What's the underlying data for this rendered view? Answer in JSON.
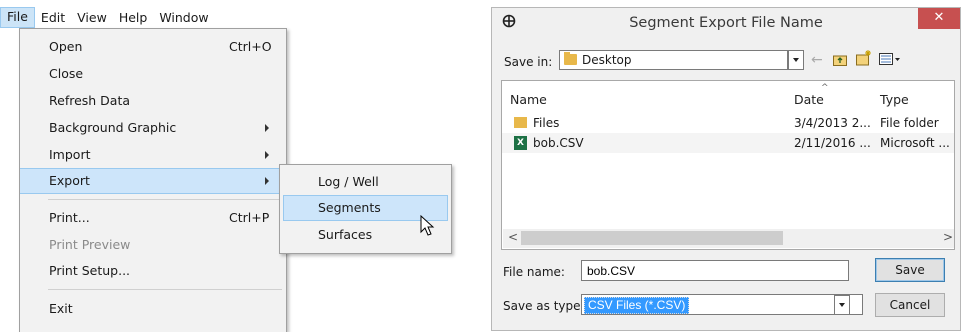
{
  "menubar": {
    "items": [
      "File",
      "Edit",
      "View",
      "Help",
      "Window"
    ]
  },
  "file_menu": {
    "items": [
      {
        "label": "Open",
        "shortcut": "Ctrl+O"
      },
      {
        "label": "Close"
      },
      {
        "label": "Refresh Data"
      },
      {
        "label": "Background Graphic",
        "submenu": true
      },
      {
        "label": "Import",
        "submenu": true
      },
      {
        "label": "Export",
        "submenu": true,
        "highlighted": true
      },
      {
        "label": "Print...",
        "shortcut": "Ctrl+P"
      },
      {
        "label": "Print Preview",
        "disabled": true
      },
      {
        "label": "Print Setup..."
      },
      {
        "label": "Exit"
      }
    ]
  },
  "export_submenu": {
    "items": [
      {
        "label": "Log / Well"
      },
      {
        "label": "Segments",
        "highlighted": true
      },
      {
        "label": "Surfaces"
      }
    ]
  },
  "dialog": {
    "title": "Segment Export File Name",
    "close_glyph": "✕",
    "save_in_label": "Save in:",
    "save_in_value": "Desktop",
    "columns": [
      "Name",
      "Date",
      "Type"
    ],
    "files": [
      {
        "name": "Files",
        "date": "3/4/2013 2...",
        "type": "File folder",
        "icon": "folder-icon"
      },
      {
        "name": "bob.CSV",
        "date": "2/11/2016 ...",
        "type": "Microsoft ...",
        "icon": "excel-file-icon"
      }
    ],
    "file_name_label": "File name:",
    "file_name_value": "bob.CSV",
    "save_as_type_label": "Save as type:",
    "save_as_type_value": "CSV Files (*.CSV)",
    "save_button": "Save",
    "cancel_button": "Cancel"
  },
  "colors": {
    "menu_highlight": "#cde5fa",
    "selection_blue": "#3399ff",
    "close_red": "#c75050"
  }
}
